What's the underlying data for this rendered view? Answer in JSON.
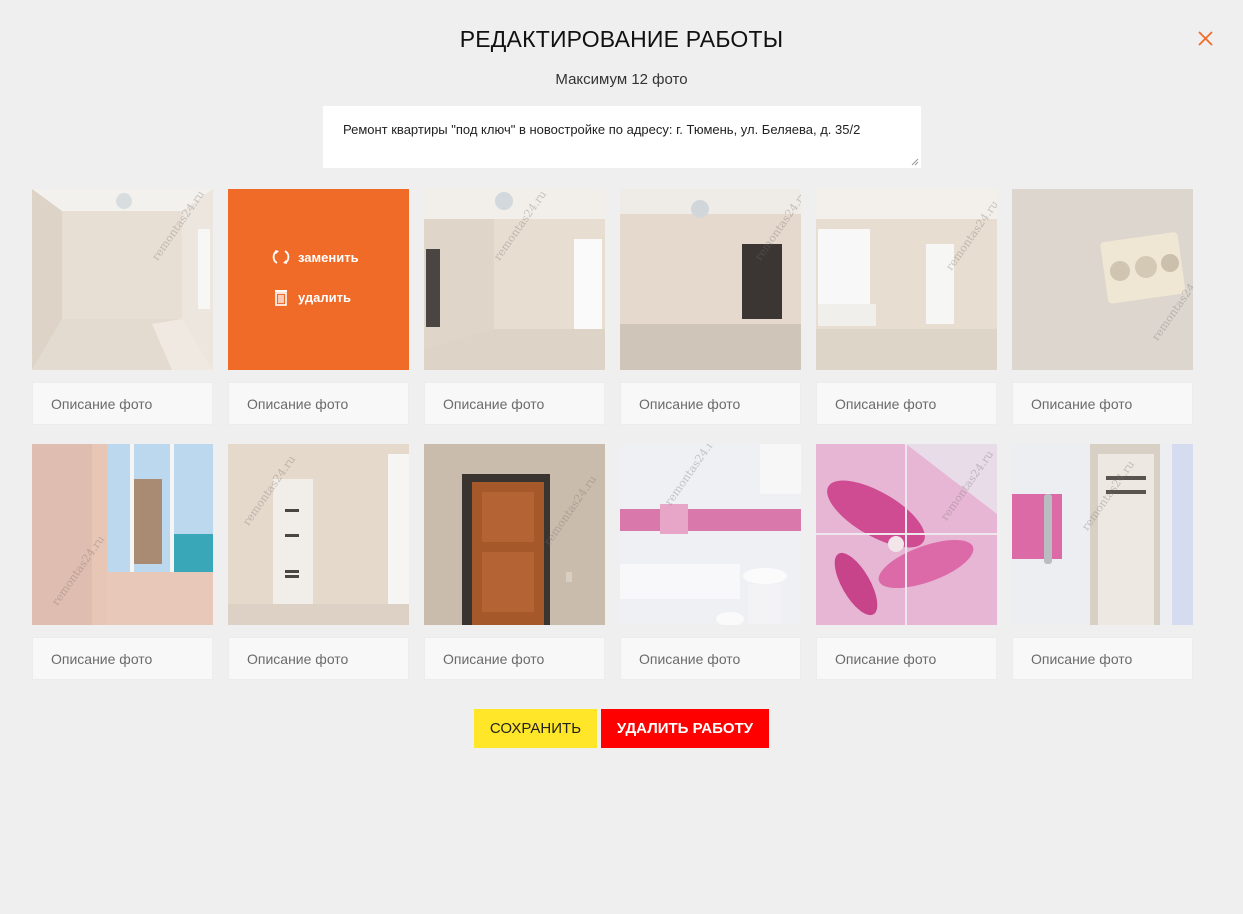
{
  "dialog": {
    "title": "РЕДАКТИРОВАНИЕ РАБОТЫ",
    "subtitle": "Максимум 12 фото",
    "description": "Ремонт квартиры \"под ключ\" в новостройке по адресу: г. Тюмень, ул. Беляева, д. 35/2"
  },
  "overlay": {
    "replace_label": "заменить",
    "delete_label": "удалить"
  },
  "watermark": "remontas24.ru",
  "photos": [
    {
      "caption_placeholder": "Описание фото",
      "scene": "empty-room"
    },
    {
      "caption_placeholder": "Описание фото",
      "scene": "empty-room-hovered"
    },
    {
      "caption_placeholder": "Описание фото",
      "scene": "room-corner"
    },
    {
      "caption_placeholder": "Описание фото",
      "scene": "room-doorway"
    },
    {
      "caption_placeholder": "Описание фото",
      "scene": "room-window"
    },
    {
      "caption_placeholder": "Описание фото",
      "scene": "wall-socket"
    },
    {
      "caption_placeholder": "Описание фото",
      "scene": "balcony"
    },
    {
      "caption_placeholder": "Описание фото",
      "scene": "hallway-door"
    },
    {
      "caption_placeholder": "Описание фото",
      "scene": "entrance-door"
    },
    {
      "caption_placeholder": "Описание фото",
      "scene": "bathroom"
    },
    {
      "caption_placeholder": "Описание фото",
      "scene": "tile-flowers"
    },
    {
      "caption_placeholder": "Описание фото",
      "scene": "bathroom-door"
    }
  ],
  "buttons": {
    "save_label": "СОХРАНИТЬ",
    "delete_label": "УДАЛИТЬ РАБОТУ"
  },
  "colors": {
    "accent": "#f06a28",
    "save": "#ffe628",
    "delete": "#ff0000"
  }
}
